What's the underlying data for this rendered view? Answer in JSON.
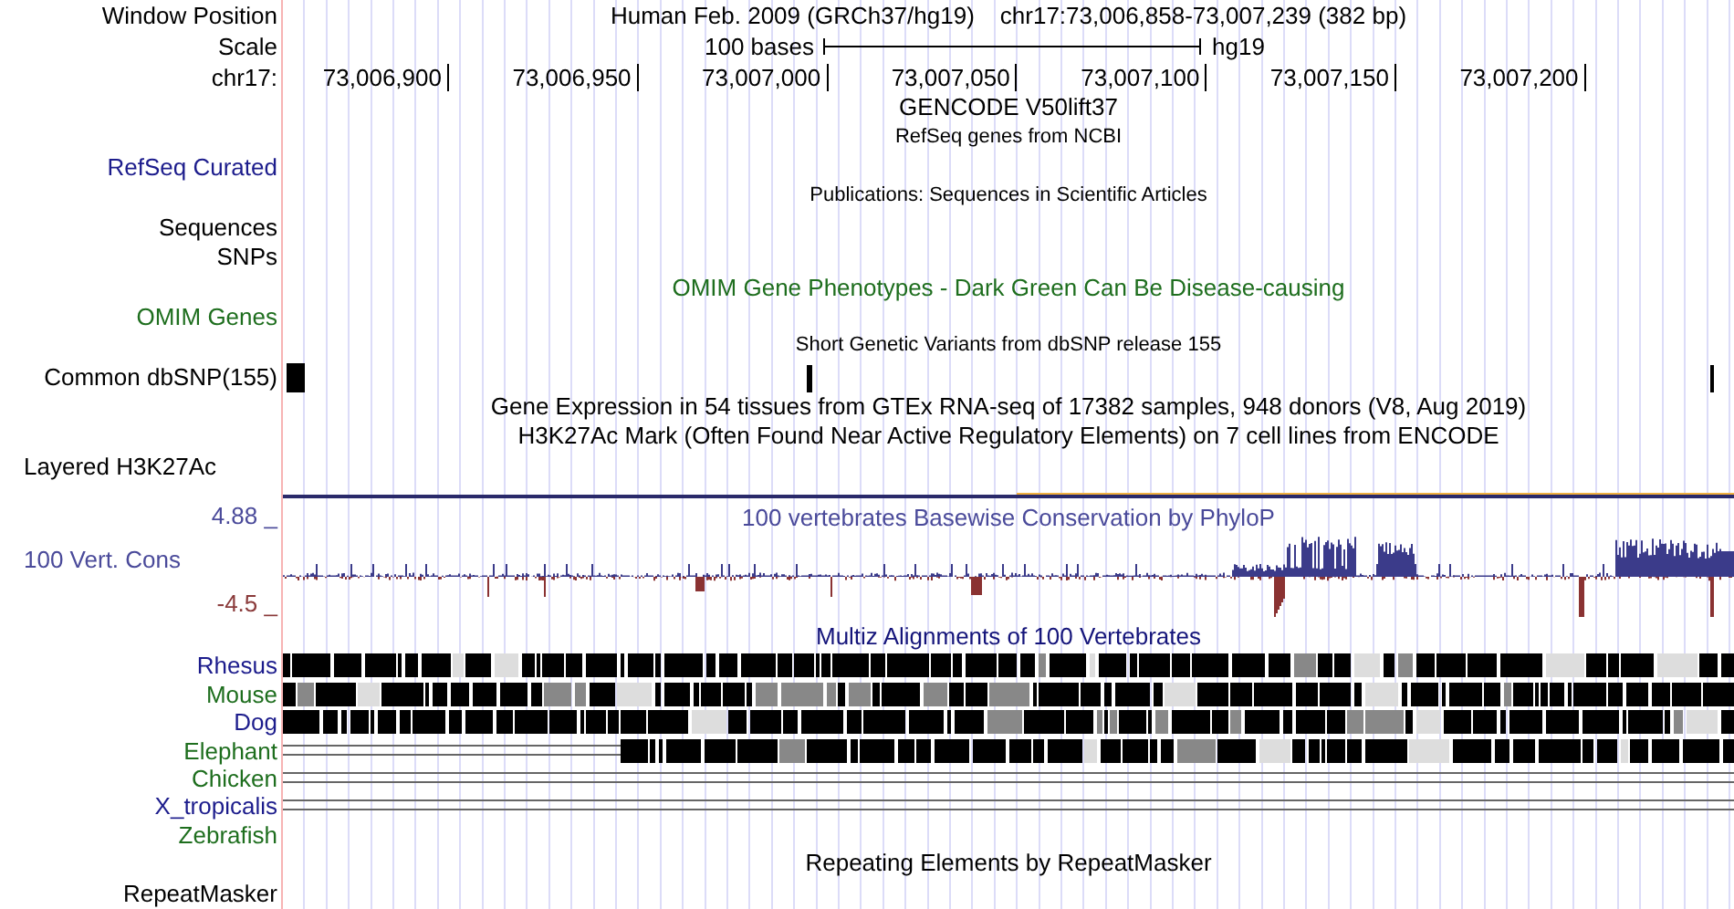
{
  "position": {
    "label": "Window Position",
    "assembly": "Human Feb. 2009 (GRCh37/hg19)",
    "range": "chr17:73,006,858-73,007,239 (382 bp)"
  },
  "scale": {
    "label": "Scale",
    "bar": "100 bases",
    "db": "hg19"
  },
  "ruler": {
    "label": "chr17:",
    "ticks": [
      "73,006,900",
      "73,006,950",
      "73,007,000",
      "73,007,050",
      "73,007,100",
      "73,007,150",
      "73,007,200"
    ]
  },
  "tracks": [
    {
      "kind": "title",
      "text": "GENCODE V50lift37",
      "color": "#000000"
    },
    {
      "kind": "subtitle",
      "text": "RefSeq genes from NCBI",
      "color": "#000000"
    },
    {
      "kind": "label",
      "text": "RefSeq Curated",
      "color": "#1c1c8c"
    },
    {
      "kind": "subtitle",
      "text": "Publications: Sequences in Scientific Articles",
      "color": "#000000"
    },
    {
      "kind": "label",
      "text": "Sequences",
      "color": "#000000"
    },
    {
      "kind": "label",
      "text": "SNPs",
      "color": "#000000"
    },
    {
      "kind": "title",
      "text": "OMIM Gene Phenotypes - Dark Green Can Be Disease-causing",
      "color": "#1e6e1e"
    },
    {
      "kind": "label",
      "text": "OMIM Genes",
      "color": "#1e6e1e"
    },
    {
      "kind": "subtitle",
      "text": "Short Genetic Variants from dbSNP release 155",
      "color": "#000000"
    },
    {
      "kind": "snp",
      "text": "Common dbSNP(155)"
    },
    {
      "kind": "title",
      "text": "Gene Expression in 54 tissues from GTEx RNA-seq of 17382 samples, 948 donors (V8, Aug 2019)",
      "color": "#000000"
    },
    {
      "kind": "title",
      "text": "H3K27Ac Mark (Often Found Near Active Regulatory Elements) on 7 cell lines from ENCODE",
      "color": "#000000"
    },
    {
      "kind": "group-label",
      "text": "Layered H3K27Ac",
      "color": "#000000"
    },
    {
      "kind": "rule"
    },
    {
      "kind": "wiggle",
      "title": "100 vertebrates Basewise Conservation by PhyloP",
      "label": "100 Vert. Cons",
      "max": "4.88 _",
      "min": "-4.5 _"
    },
    {
      "kind": "title",
      "text": "Multiz Alignments of 100 Vertebrates",
      "color": "#14147a"
    },
    {
      "kind": "species-aligned",
      "text": "Rhesus",
      "color": "#1c1c8c"
    },
    {
      "kind": "species-aligned",
      "text": "Mouse",
      "color": "#1e6e1e"
    },
    {
      "kind": "species-aligned",
      "text": "Dog",
      "color": "#1c1c8c"
    },
    {
      "kind": "species-partial",
      "text": "Elephant",
      "color": "#1e6e1e"
    },
    {
      "kind": "species-gap",
      "text": "Chicken",
      "color": "#1e6e1e"
    },
    {
      "kind": "species-gap",
      "text": "X_tropicalis",
      "color": "#1c1c8c"
    },
    {
      "kind": "species-empty",
      "text": "Zebrafish",
      "color": "#1e6e1e"
    },
    {
      "kind": "title",
      "text": "Repeating Elements by RepeatMasker",
      "color": "#000000"
    },
    {
      "kind": "label",
      "text": "RepeatMasker",
      "color": "#000000"
    }
  ]
}
